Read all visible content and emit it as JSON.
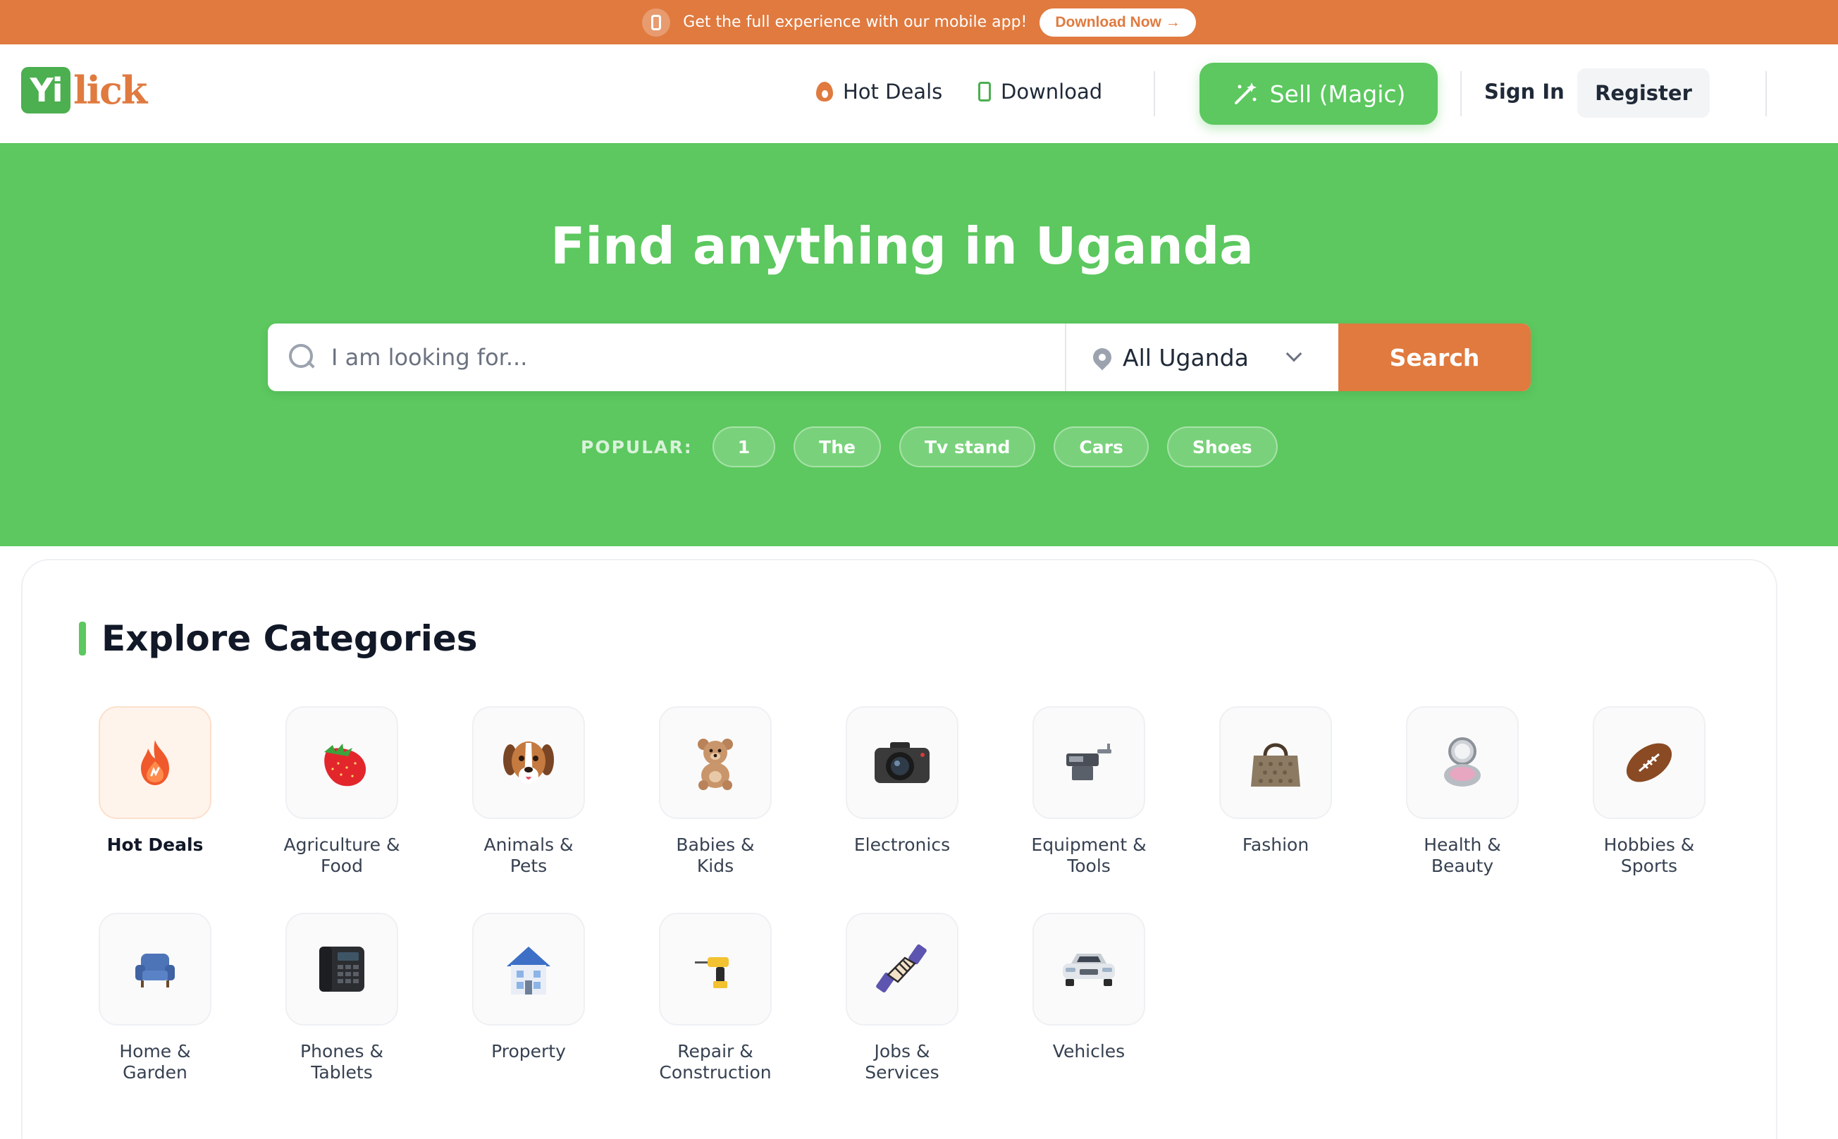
{
  "banner": {
    "message": "Get the full experience with our mobile app!",
    "button": "Download Now →",
    "icon": "mobile-phone-icon"
  },
  "header": {
    "logo_box": "Yi",
    "logo_rest": "lick",
    "hot_deals": "Hot Deals",
    "download": "Download",
    "sell": "Sell (Magic)",
    "sign_in": "Sign In",
    "register": "Register"
  },
  "hero": {
    "title": "Find anything in Uganda",
    "search_placeholder": "I am looking for...",
    "location": "All Uganda",
    "search_button": "Search",
    "popular_label": "POPULAR:",
    "popular": [
      "1",
      "The",
      "Tv stand",
      "Cars",
      "Shoes"
    ]
  },
  "categories": {
    "title": "Explore Categories",
    "items": [
      {
        "line1": "Hot Deals",
        "line2": "",
        "icon": "fire-icon"
      },
      {
        "line1": "Agriculture &",
        "line2": "Food",
        "icon": "strawberry-icon"
      },
      {
        "line1": "Animals &",
        "line2": "Pets",
        "icon": "dog-icon"
      },
      {
        "line1": "Babies &",
        "line2": "Kids",
        "icon": "teddy-bear-icon"
      },
      {
        "line1": "Electronics",
        "line2": "",
        "icon": "camera-icon"
      },
      {
        "line1": "Equipment &",
        "line2": "Tools",
        "icon": "machine-tool-icon"
      },
      {
        "line1": "Fashion",
        "line2": "",
        "icon": "handbag-icon"
      },
      {
        "line1": "Health &",
        "line2": "Beauty",
        "icon": "compact-mirror-icon"
      },
      {
        "line1": "Hobbies &",
        "line2": "Sports",
        "icon": "football-icon"
      },
      {
        "line1": "Home &",
        "line2": "Garden",
        "icon": "armchair-icon"
      },
      {
        "line1": "Phones &",
        "line2": "Tablets",
        "icon": "desk-phone-icon"
      },
      {
        "line1": "Property",
        "line2": "",
        "icon": "house-icon"
      },
      {
        "line1": "Repair &",
        "line2": "Construction",
        "icon": "drill-icon"
      },
      {
        "line1": "Jobs &",
        "line2": "Services",
        "icon": "handshake-icon"
      },
      {
        "line1": "Vehicles",
        "line2": "",
        "icon": "car-icon"
      }
    ]
  },
  "colors": {
    "brand_green": "#5cc85f",
    "brand_orange": "#e07a3f"
  }
}
